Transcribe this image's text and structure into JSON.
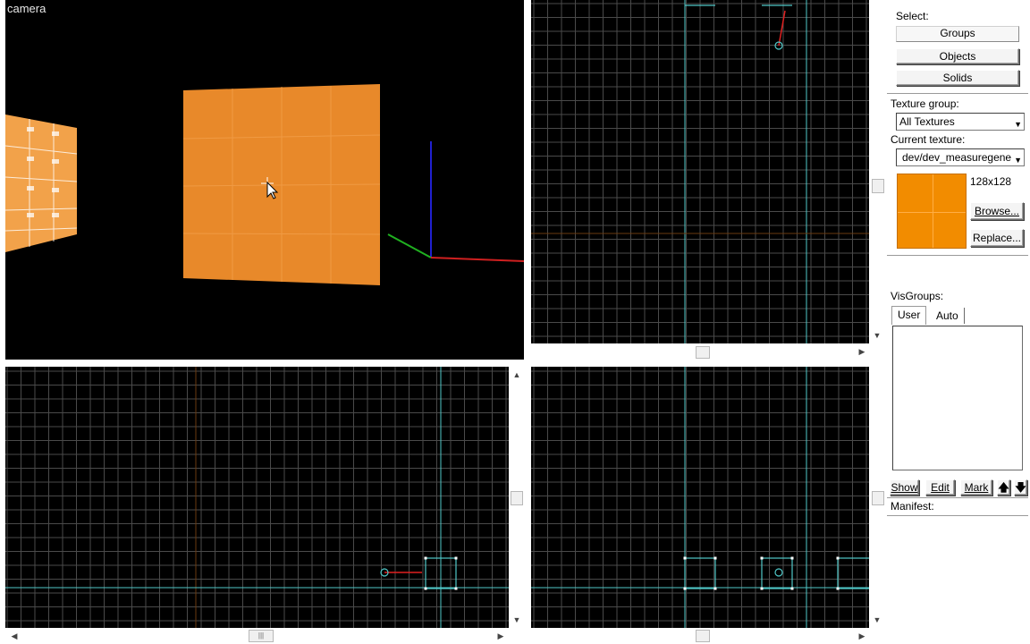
{
  "camera_view": {
    "label": "camera"
  },
  "panel": {
    "select_label": "Select:",
    "select_buttons": [
      "Groups",
      "Objects",
      "Solids"
    ],
    "texture_group_label": "Texture group:",
    "texture_group_value": "All Textures",
    "current_texture_label": "Current texture:",
    "current_texture_value": "dev/dev_measuregene",
    "texture_size": "128x128",
    "browse_label": "Browse...",
    "replace_label": "Replace...",
    "visgroups_label": "VisGroups:",
    "visgroup_tabs": [
      "User",
      "Auto"
    ],
    "visgroup_buttons": {
      "show": "Show",
      "edit": "Edit",
      "mark": "Mark"
    },
    "manifest_label": "Manifest:"
  },
  "colors": {
    "viewport_bg": "#000000",
    "grid": "#4a4a4a",
    "grid_major": "#707070",
    "axis_orange": "#6a3a10",
    "selection_cyan": "#4fc8c8",
    "texture_orange": "#f28c00"
  },
  "icons": {
    "dropdown": "chevron-down-icon",
    "move_up": "arrow-up-icon",
    "move_down": "arrow-down-icon"
  }
}
